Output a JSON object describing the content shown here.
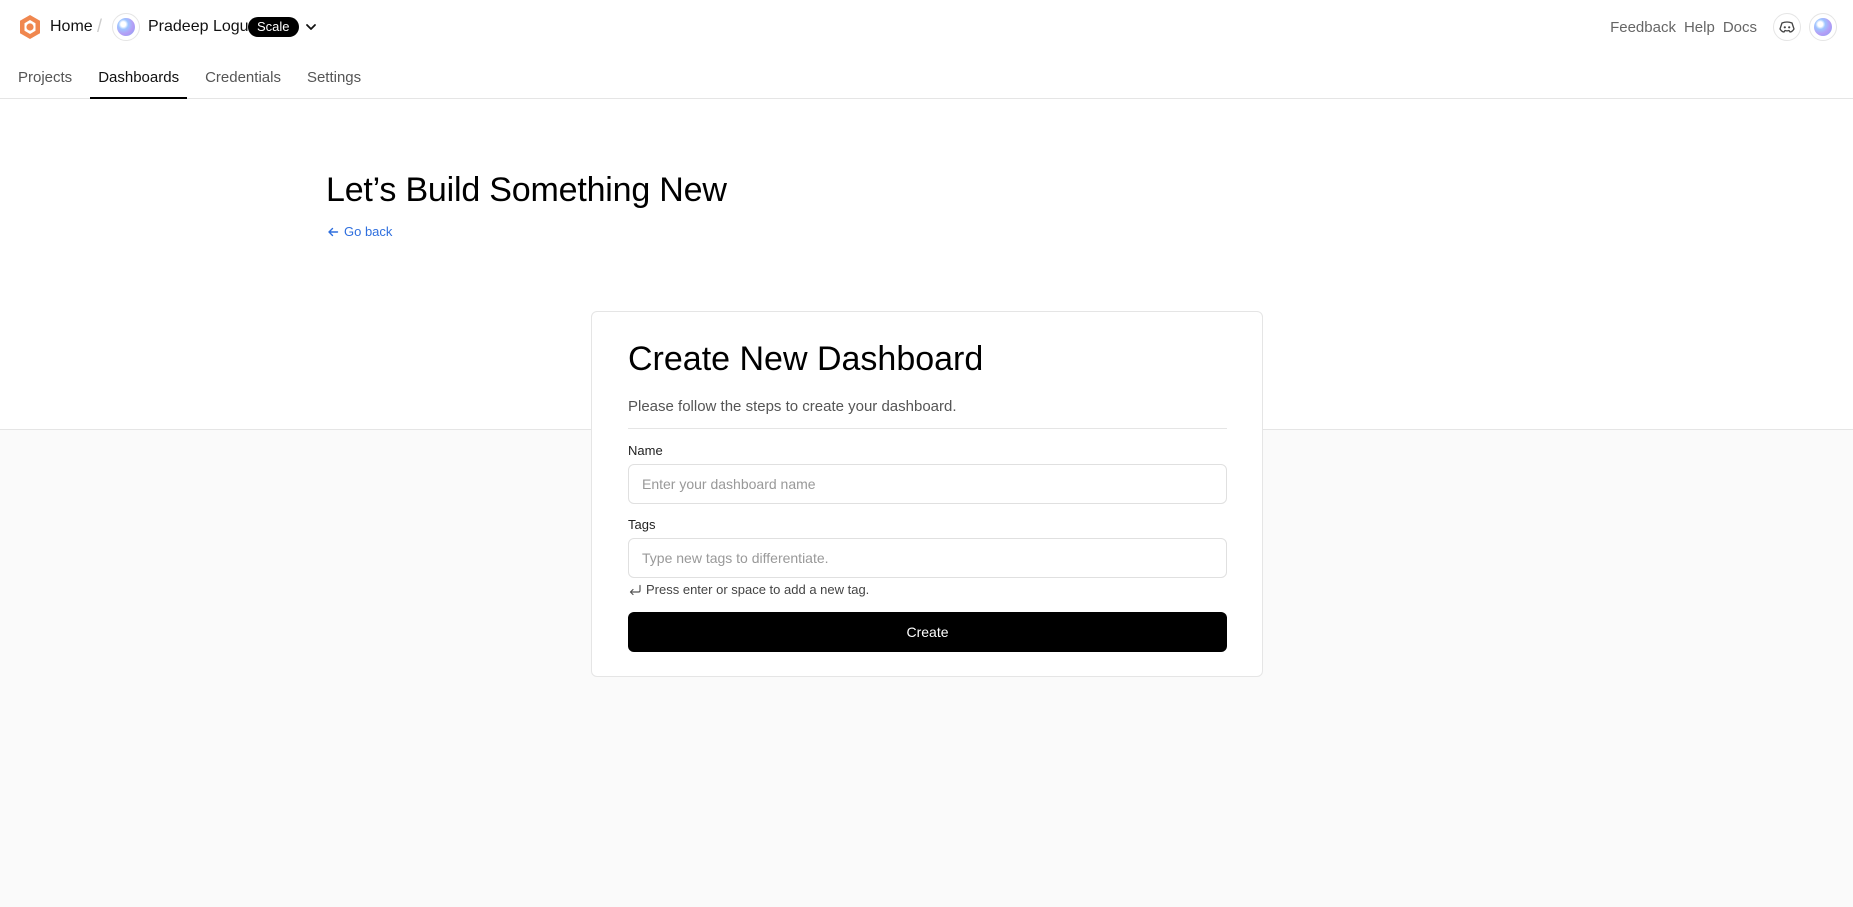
{
  "header": {
    "home_label": "Home",
    "org_name": "Pradeep Logu",
    "plan_badge": "Scale",
    "right_links": {
      "feedback": "Feedback",
      "help": "Help",
      "docs": "Docs"
    }
  },
  "tabs": [
    {
      "label": "Projects",
      "active": false
    },
    {
      "label": "Dashboards",
      "active": true
    },
    {
      "label": "Credentials",
      "active": false
    },
    {
      "label": "Settings",
      "active": false
    }
  ],
  "hero": {
    "title": "Let’s Build Something New",
    "go_back_label": "Go back"
  },
  "form": {
    "title": "Create New Dashboard",
    "subtitle": "Please follow the steps to create your dashboard.",
    "name": {
      "label": "Name",
      "value": "",
      "placeholder": "Enter your dashboard name"
    },
    "tags": {
      "label": "Tags",
      "value": "",
      "placeholder": "Type new tags to differentiate.",
      "hint": "Press enter or space to add a new tag."
    },
    "submit_label": "Create"
  },
  "colors": {
    "brand": "#f0874f",
    "link": "#2f6fde",
    "primary_button": "#000000"
  }
}
